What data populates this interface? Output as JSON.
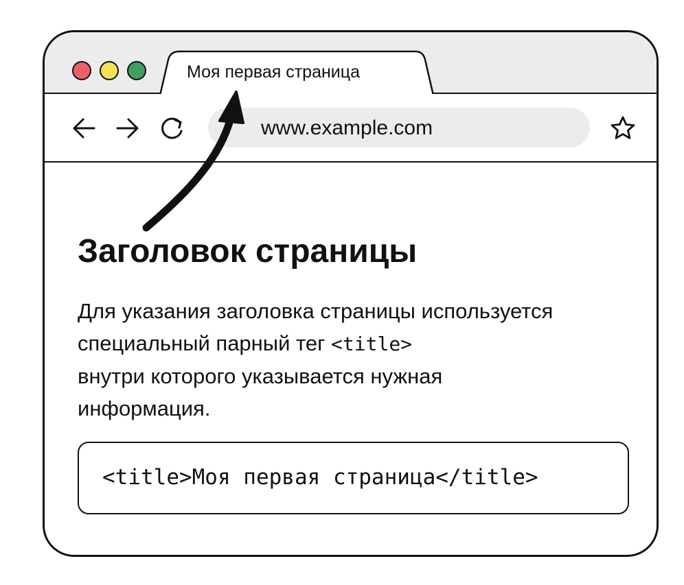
{
  "browser": {
    "tab": {
      "title": "Моя первая страница"
    },
    "address_bar": {
      "url": "www.example.com"
    },
    "nav": [
      "back-arrow-icon",
      "forward-arrow-icon",
      "reload-icon"
    ],
    "bookmark_icon": "star-icon"
  },
  "page": {
    "heading": "Заголовок страницы",
    "paragraph": {
      "line1": "Для указания заголовка страницы используется",
      "line2_before": "специальный парный тег ",
      "line2_tag": "<title>",
      "line3": "внутри которого указывается нужная",
      "line4": "информация."
    },
    "code_example": "<title>Моя первая страница</title>"
  },
  "colors": {
    "traffic_red": "#ee5f6c",
    "traffic_yellow": "#f5e15a",
    "traffic_green": "#3f9f63",
    "chrome_gray": "#ececee",
    "outline": "#111111"
  }
}
